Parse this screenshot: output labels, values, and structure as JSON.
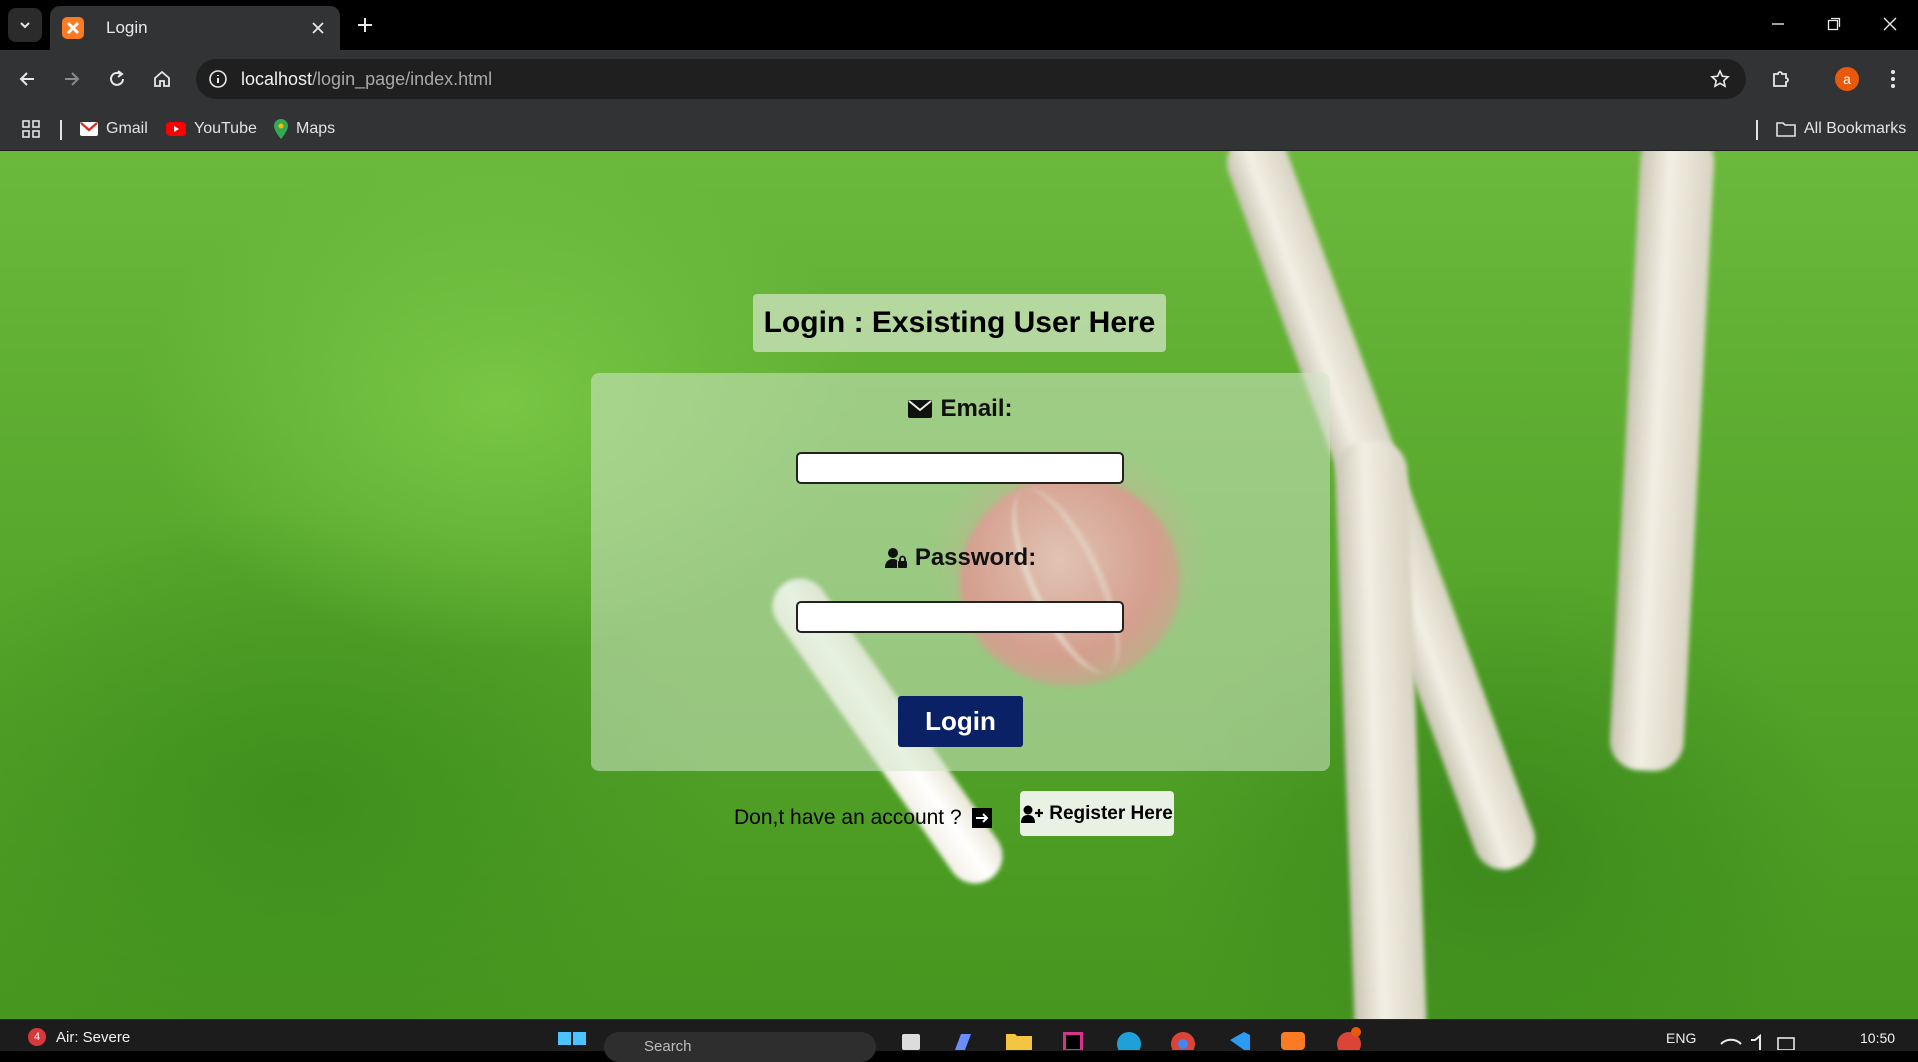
{
  "browser": {
    "tab_title": "Login",
    "url_host": "localhost",
    "url_path": "/login_page/index.html",
    "profile_initial": "a",
    "bookmarks": [
      {
        "label": "Gmail",
        "icon": "gmail-icon"
      },
      {
        "label": "YouTube",
        "icon": "youtube-icon"
      },
      {
        "label": "Maps",
        "icon": "maps-icon"
      }
    ],
    "all_bookmarks": "All Bookmarks"
  },
  "page": {
    "heading": "Login : Exsisting User Here",
    "email_label": "Email:",
    "password_label": "Password:",
    "email_value": "",
    "password_value": "",
    "login_button": "Login",
    "no_account_text": "Don,t have an account ?",
    "register_button": "Register Here",
    "colors": {
      "login_button": "#0b2166",
      "accent_orange": "#fb7a24"
    }
  },
  "taskbar": {
    "weather_badge": "4",
    "weather_text": "Air: Severe",
    "search_placeholder": "Search",
    "language": "ENG",
    "time": "10:50"
  }
}
